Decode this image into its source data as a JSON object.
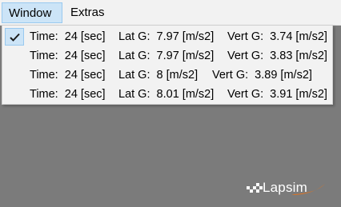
{
  "menubar": {
    "items": [
      {
        "label": "Window"
      },
      {
        "label": "Extras"
      }
    ]
  },
  "dropdown": {
    "rows": [
      {
        "checked": true,
        "time": "Time:  24 [sec]",
        "lat": "Lat G:  7.97 [m/s2]",
        "vert": "Vert G:  3.74 [m/s2]"
      },
      {
        "checked": false,
        "time": "Time:  24 [sec]",
        "lat": "Lat G:  7.97 [m/s2]",
        "vert": "Vert G:  3.83 [m/s2]"
      },
      {
        "checked": false,
        "time": "Time:  24 [sec]",
        "lat": "Lat G:  8 [m/s2]",
        "vert": "Vert G:  3.89 [m/s2]"
      },
      {
        "checked": false,
        "time": "Time:  24 [sec]",
        "lat": "Lat G:  8.01 [m/s2]",
        "vert": "Vert G:  3.91 [m/s2]"
      }
    ]
  },
  "logo": {
    "text": "Lapsim",
    "accent_color": "#e8731a"
  },
  "colors": {
    "background": "#7b7b7b",
    "menu_bg": "#f2f2f2",
    "highlight": "#cce4f7"
  }
}
